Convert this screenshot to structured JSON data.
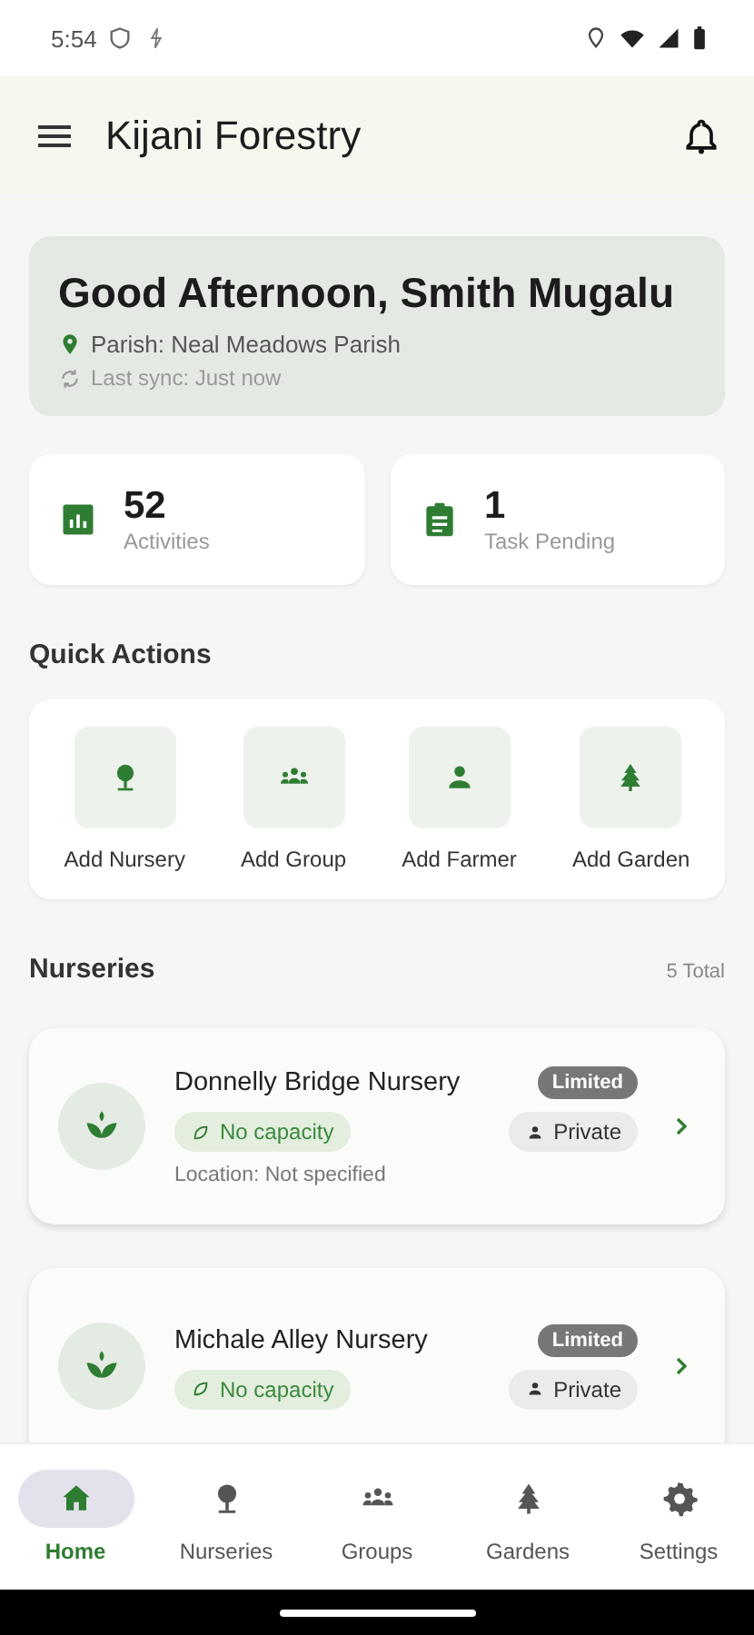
{
  "status_bar": {
    "time": "5:54"
  },
  "app_bar": {
    "title": "Kijani Forestry"
  },
  "greeting": {
    "title": "Good Afternoon, Smith Mugalu",
    "parish": "Parish: Neal Meadows Parish",
    "sync": "Last sync: Just now"
  },
  "stats": [
    {
      "kind": "chart",
      "value": "52",
      "label": "Activities"
    },
    {
      "kind": "task",
      "value": "1",
      "label": "Task Pending"
    }
  ],
  "quick_actions": {
    "title": "Quick Actions",
    "items": [
      {
        "kind": "nursery",
        "label": "Add Nursery"
      },
      {
        "kind": "group",
        "label": "Add Group"
      },
      {
        "kind": "farmer",
        "label": "Add Farmer"
      },
      {
        "kind": "garden",
        "label": "Add Garden"
      }
    ]
  },
  "nurseries": {
    "title": "Nurseries",
    "total": "5 Total",
    "items": [
      {
        "name": "Donnelly Bridge Nursery",
        "badge": "Limited",
        "capacity": "No capacity",
        "ownership": "Private",
        "location": "Location: Not specified"
      },
      {
        "name": "Michale Alley Nursery",
        "badge": "Limited",
        "capacity": "No capacity",
        "ownership": "Private"
      }
    ]
  },
  "nav": [
    {
      "kind": "home",
      "label": "Home",
      "selected": true
    },
    {
      "kind": "nursery",
      "label": "Nurseries",
      "selected": false
    },
    {
      "kind": "group",
      "label": "Groups",
      "selected": false
    },
    {
      "kind": "garden",
      "label": "Gardens",
      "selected": false
    },
    {
      "kind": "settings",
      "label": "Settings",
      "selected": false
    }
  ]
}
